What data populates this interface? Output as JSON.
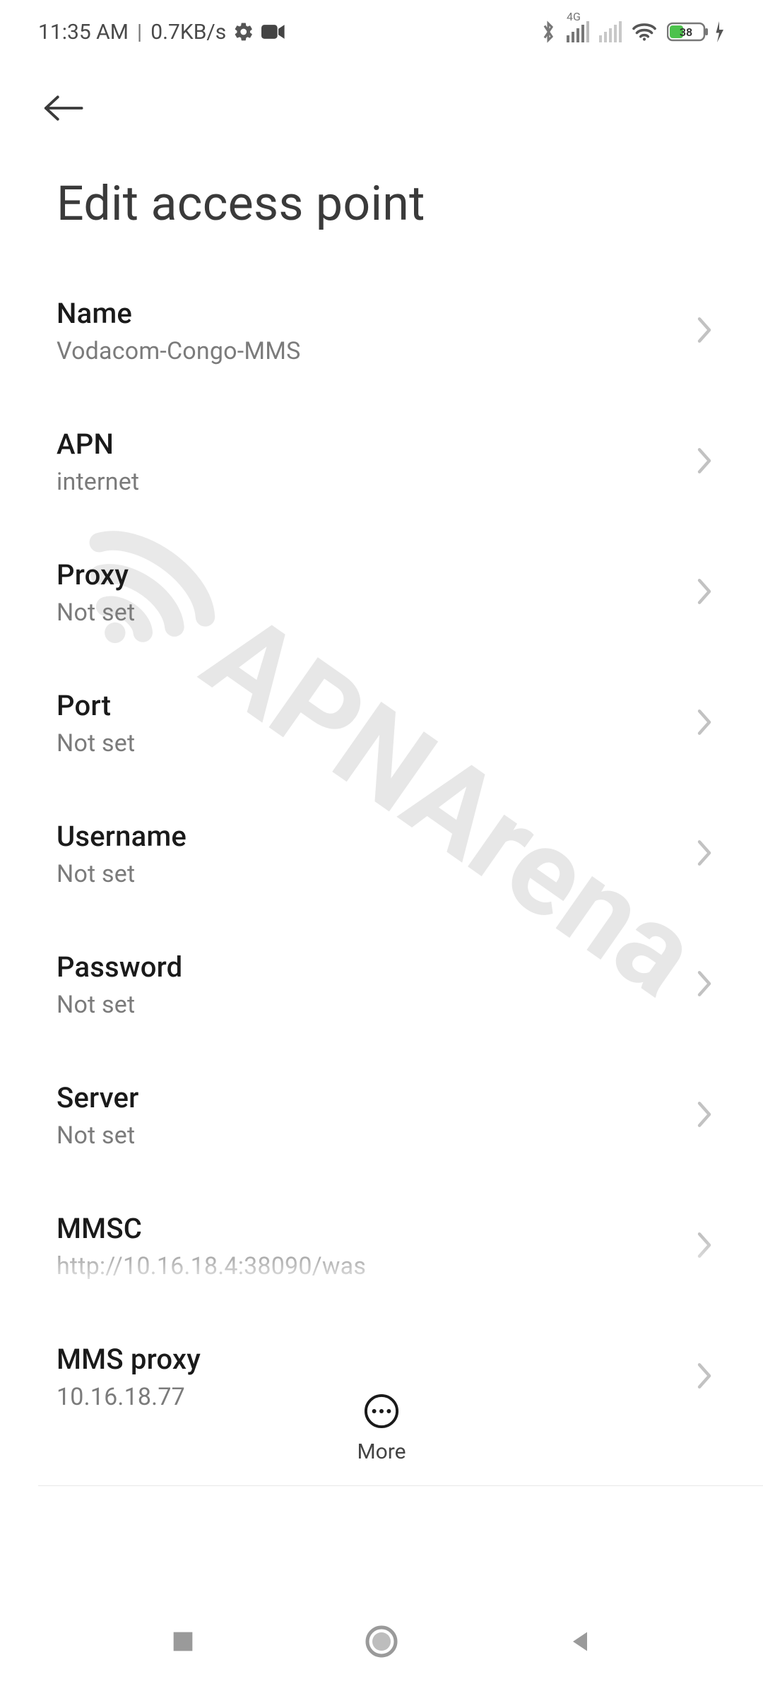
{
  "status": {
    "time": "11:35 AM",
    "net_speed": "0.7KB/s",
    "battery_text": "38",
    "signal_label": "4G"
  },
  "page": {
    "title": "Edit access point"
  },
  "rows": [
    {
      "label": "Name",
      "value": "Vodacom-Congo-MMS"
    },
    {
      "label": "APN",
      "value": "internet"
    },
    {
      "label": "Proxy",
      "value": "Not set"
    },
    {
      "label": "Port",
      "value": "Not set"
    },
    {
      "label": "Username",
      "value": "Not set"
    },
    {
      "label": "Password",
      "value": "Not set"
    },
    {
      "label": "Server",
      "value": "Not set"
    },
    {
      "label": "MMSC",
      "value": "http://10.16.18.4:38090/was"
    },
    {
      "label": "MMS proxy",
      "value": "10.16.18.77"
    }
  ],
  "more": {
    "label": "More"
  },
  "watermark": {
    "text": "APNArena"
  }
}
